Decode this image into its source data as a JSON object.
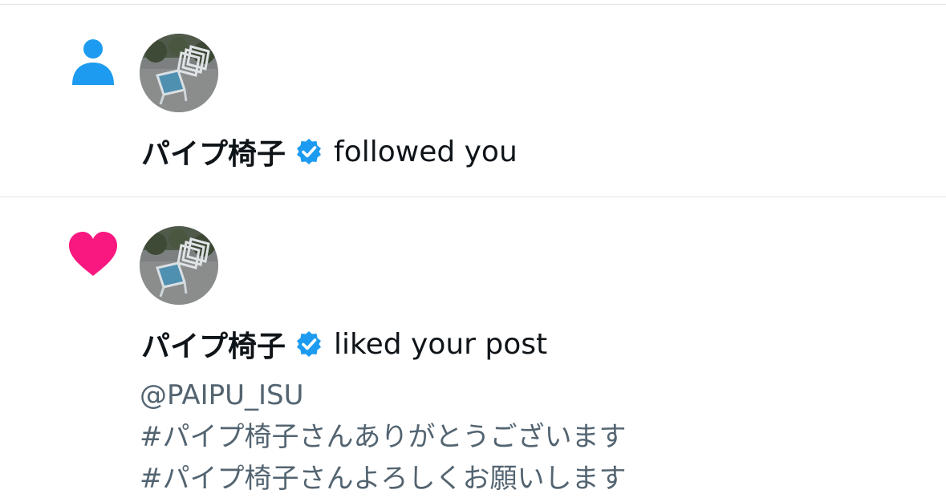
{
  "colors": {
    "follow_icon": "#1d9bf0",
    "like_icon": "#f91880",
    "verified_badge": "#1d9bf0",
    "secondary_text": "#536471",
    "divider": "#e1e6ea"
  },
  "notifications": [
    {
      "type_icon": "person-icon",
      "avatar": "folding-chairs-photo",
      "user_name": "パイプ椅子",
      "verified": true,
      "action": "followed you"
    },
    {
      "type_icon": "heart-icon",
      "avatar": "folding-chairs-photo",
      "user_name": "パイプ椅子",
      "verified": true,
      "action": "liked your post",
      "post_lines": [
        "@PAIPU_ISU",
        "#パイプ椅子さんありがとうございます",
        "#パイプ椅子さんよろしくお願いします"
      ]
    }
  ]
}
